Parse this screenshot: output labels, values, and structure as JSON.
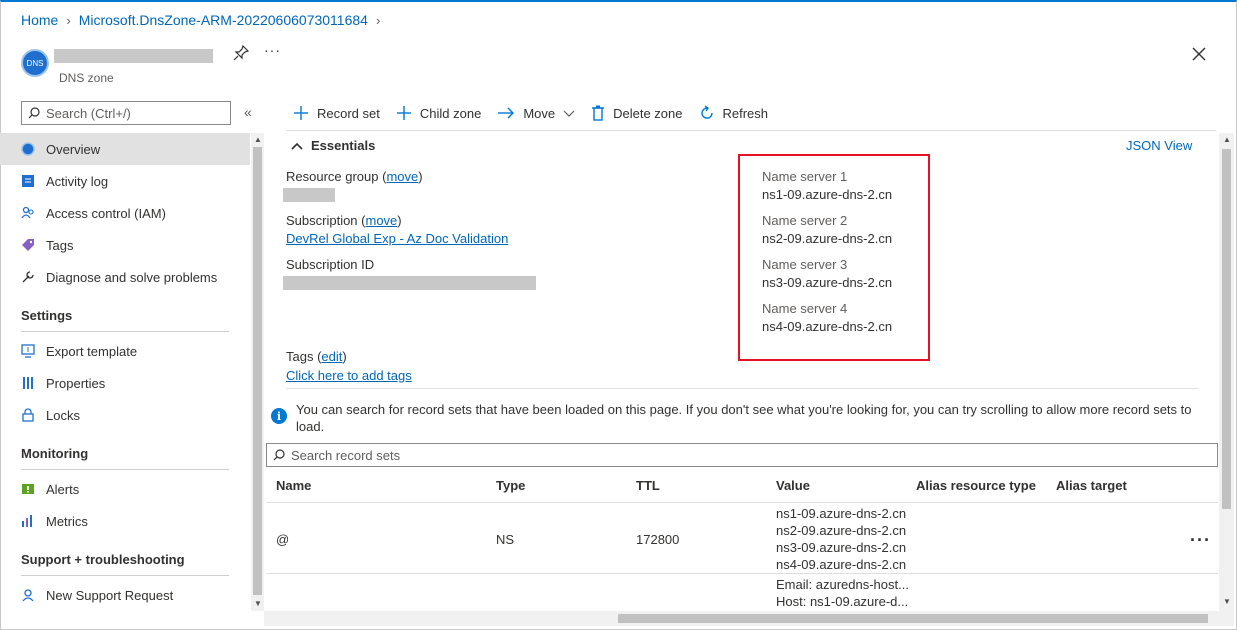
{
  "breadcrumb": {
    "home": "Home",
    "resource": "Microsoft.DnsZone-ARM-20220606073011684"
  },
  "header": {
    "avatar_text": "DNS",
    "subtitle": "DNS zone",
    "more": "···"
  },
  "sidebar": {
    "search_placeholder": "Search (Ctrl+/)",
    "collapse": "«",
    "items": [
      {
        "label": "Overview",
        "icon": "dns-zone-icon",
        "active": true
      },
      {
        "label": "Activity log",
        "icon": "activity-log-icon"
      },
      {
        "label": "Access control (IAM)",
        "icon": "people-icon"
      },
      {
        "label": "Tags",
        "icon": "tag-icon"
      },
      {
        "label": "Diagnose and solve problems",
        "icon": "wrench-icon"
      }
    ],
    "sections": [
      {
        "title": "Settings",
        "items": [
          {
            "label": "Export template",
            "icon": "export-icon"
          },
          {
            "label": "Properties",
            "icon": "properties-icon"
          },
          {
            "label": "Locks",
            "icon": "lock-icon"
          }
        ]
      },
      {
        "title": "Monitoring",
        "items": [
          {
            "label": "Alerts",
            "icon": "alert-icon"
          },
          {
            "label": "Metrics",
            "icon": "metrics-icon"
          }
        ]
      },
      {
        "title": "Support + troubleshooting",
        "items": [
          {
            "label": "New Support Request",
            "icon": "support-icon"
          }
        ]
      }
    ]
  },
  "toolbar": {
    "record_set": "Record set",
    "child_zone": "Child zone",
    "move": "Move",
    "delete_zone": "Delete zone",
    "refresh": "Refresh"
  },
  "essentials": {
    "title": "Essentials",
    "json_view": "JSON View",
    "resource_group_label": "Resource group",
    "move_link": "move",
    "subscription_label": "Subscription",
    "subscription_value": "DevRel Global Exp - Az Doc Validation",
    "subscription_id_label": "Subscription ID",
    "tags_label": "Tags",
    "edit_link": "edit",
    "add_tags": "Click here to add tags",
    "name_servers": [
      {
        "label": "Name server 1",
        "value": "ns1-09.azure-dns-2.cn"
      },
      {
        "label": "Name server 2",
        "value": "ns2-09.azure-dns-2.cn"
      },
      {
        "label": "Name server 3",
        "value": "ns3-09.azure-dns-2.cn"
      },
      {
        "label": "Name server 4",
        "value": "ns4-09.azure-dns-2.cn"
      }
    ]
  },
  "info_message": "You can search for record sets that have been loaded on this page. If you don't see what you're looking for, you can try scrolling to allow more record sets to load.",
  "record_search_placeholder": "Search record sets",
  "table": {
    "columns": [
      "Name",
      "Type",
      "TTL",
      "Value",
      "Alias resource type",
      "Alias target"
    ],
    "rows": [
      {
        "name": "@",
        "type": "NS",
        "ttl": "172800",
        "values": [
          "ns1-09.azure-dns-2.cn",
          "ns2-09.azure-dns-2.cn",
          "ns3-09.azure-dns-2.cn",
          "ns4-09.azure-dns-2.cn"
        ],
        "more": "···"
      },
      {
        "values": [
          "Email: azuredns-host...",
          "Host: ns1-09.azure-d..."
        ]
      }
    ]
  },
  "colors": {
    "accent": "#0078d4",
    "link": "#0066b8",
    "highlight_box": "#e81123"
  }
}
